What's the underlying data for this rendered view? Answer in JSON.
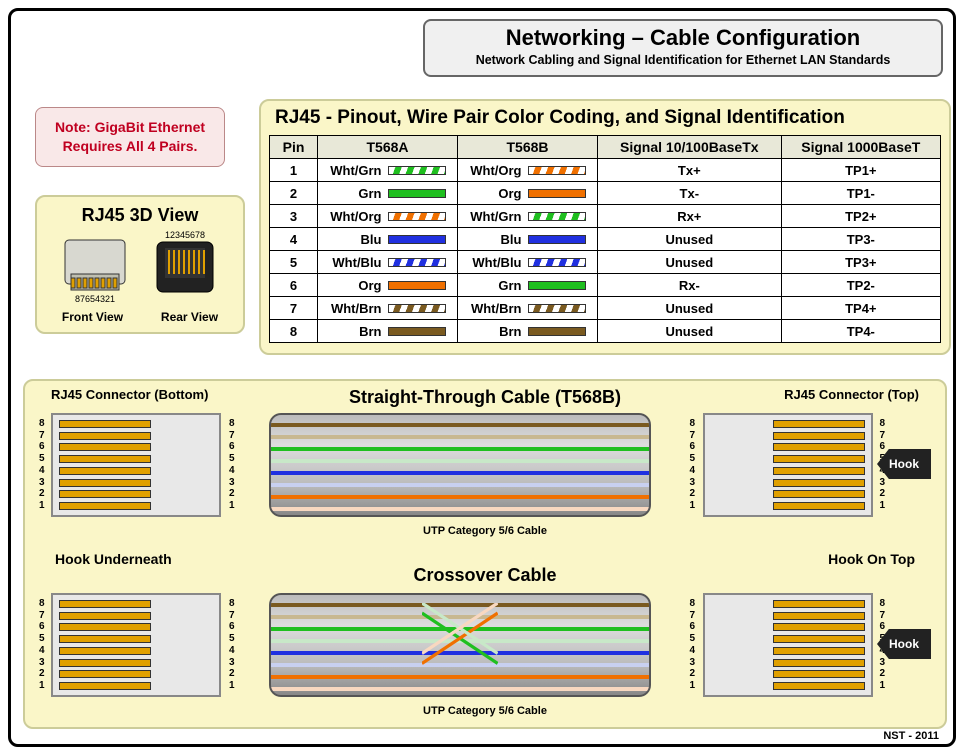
{
  "header": {
    "title": "Networking – Cable Configuration",
    "subtitle": "Network Cabling and Signal Identification for Ethernet LAN Standards"
  },
  "note": {
    "line1": "Note: GigaBit Ethernet",
    "line2": "Requires All 4 Pairs."
  },
  "view3d": {
    "title": "RJ45 3D View",
    "top_nums": "12345678",
    "bot_nums": "87654321",
    "front": "Front View",
    "rear": "Rear View"
  },
  "pinout": {
    "title": "RJ45 -  Pinout, Wire Pair Color Coding, and Signal Identification",
    "cols": {
      "pin": "Pin",
      "a": "T568A",
      "b": "T568B",
      "s100": "Signal 10/100BaseTx",
      "s1000": "Signal 1000BaseT"
    },
    "rows": [
      {
        "pin": "1",
        "a_name": "Wht/Grn",
        "a_class": "s-grn",
        "b_name": "Wht/Org",
        "b_class": "s-org",
        "s100": "Tx+",
        "s1000": "TP1+"
      },
      {
        "pin": "2",
        "a_name": "Grn",
        "a_class": "c-grn",
        "b_name": "Org",
        "b_class": "c-org",
        "s100": "Tx-",
        "s1000": "TP1-"
      },
      {
        "pin": "3",
        "a_name": "Wht/Org",
        "a_class": "s-org",
        "b_name": "Wht/Grn",
        "b_class": "s-grn",
        "s100": "Rx+",
        "s1000": "TP2+"
      },
      {
        "pin": "4",
        "a_name": "Blu",
        "a_class": "c-blu",
        "b_name": "Blu",
        "b_class": "c-blu",
        "s100": "Unused",
        "s1000": "TP3-"
      },
      {
        "pin": "5",
        "a_name": "Wht/Blu",
        "a_class": "s-blu",
        "b_name": "Wht/Blu",
        "b_class": "s-blu",
        "s100": "Unused",
        "s1000": "TP3+"
      },
      {
        "pin": "6",
        "a_name": "Org",
        "a_class": "c-org",
        "b_name": "Grn",
        "b_class": "c-grn",
        "s100": "Rx-",
        "s1000": "TP2-"
      },
      {
        "pin": "7",
        "a_name": "Wht/Brn",
        "a_class": "s-brn",
        "b_name": "Wht/Brn",
        "b_class": "s-brn",
        "s100": "Unused",
        "s1000": "TP4+"
      },
      {
        "pin": "8",
        "a_name": "Brn",
        "a_class": "c-brn",
        "b_name": "Brn",
        "b_class": "c-brn",
        "s100": "Unused",
        "s1000": "TP4-"
      }
    ]
  },
  "cables": {
    "left_conn": "RJ45 Connector (Bottom)",
    "right_conn": "RJ45 Connector (Top)",
    "straight_title": "Straight-Through Cable (T568B)",
    "crossover_title": "Crossover Cable",
    "utp": "UTP Category 5/6 Cable",
    "hook": "Hook",
    "hook_under": "Hook Underneath",
    "hook_top": "Hook On Top",
    "pins_desc": [
      "8",
      "7",
      "6",
      "5",
      "4",
      "3",
      "2",
      "1"
    ],
    "strand_colors_b": [
      "#7a5a20",
      "#c8b890",
      "#1fbf1f",
      "#c8e8c8",
      "#2030e0",
      "#c8d0f0",
      "#f07000",
      "#f8d8c0"
    ]
  },
  "footer": "NST - 2011",
  "chart_data": {
    "type": "table",
    "title": "RJ45 Pinout – T568A vs T568B color coding and signal mapping",
    "columns": [
      "Pin",
      "T568A",
      "T568B",
      "Signal 10/100BaseTx",
      "Signal 1000BaseT"
    ],
    "rows": [
      [
        1,
        "White/Green",
        "White/Orange",
        "Tx+",
        "TP1+"
      ],
      [
        2,
        "Green",
        "Orange",
        "Tx-",
        "TP1-"
      ],
      [
        3,
        "White/Orange",
        "White/Green",
        "Rx+",
        "TP2+"
      ],
      [
        4,
        "Blue",
        "Blue",
        "Unused",
        "TP3-"
      ],
      [
        5,
        "White/Blue",
        "White/Blue",
        "Unused",
        "TP3+"
      ],
      [
        6,
        "Orange",
        "Green",
        "Rx-",
        "TP2-"
      ],
      [
        7,
        "White/Brown",
        "White/Brown",
        "Unused",
        "TP4+"
      ],
      [
        8,
        "Brown",
        "Brown",
        "Unused",
        "TP4-"
      ]
    ],
    "crossover_mapping_T568B_to_T568A": {
      "1": 3,
      "2": 6,
      "3": 1,
      "4": 4,
      "5": 5,
      "6": 2,
      "7": 7,
      "8": 8
    }
  }
}
